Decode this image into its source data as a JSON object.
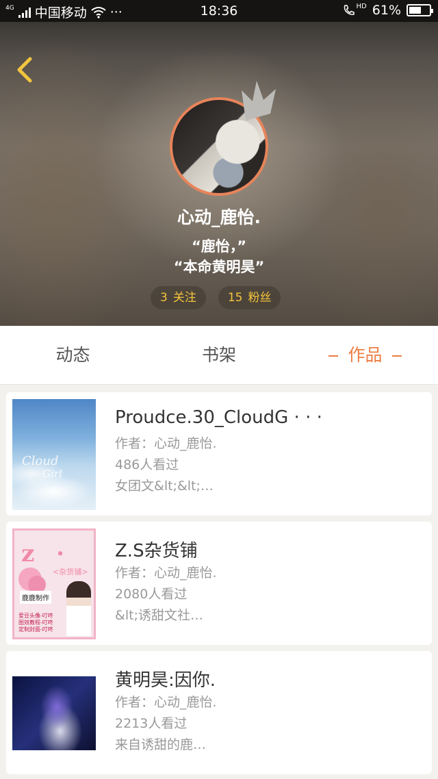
{
  "status_bar": {
    "network": "4G",
    "carrier": "中国移动",
    "more": "···",
    "time": "18:36",
    "hd": "HD",
    "battery_percent": "61%",
    "battery_level": 0.61
  },
  "profile": {
    "nickname": "心动_鹿怡.",
    "bio_line1": "“鹿怡，”",
    "bio_line2": "“本命黄明昊”",
    "following_count": "3",
    "following_label": "关注",
    "fans_count": "15",
    "fans_label": "粉丝"
  },
  "tabs": [
    {
      "label": "动态",
      "active": false
    },
    {
      "label": "书架",
      "active": false
    },
    {
      "label": "作品",
      "active": true
    }
  ],
  "works": [
    {
      "title": "Proudce.30_CloudG · · ·",
      "author": "作者：心动_鹿怡.",
      "views": "486人看过",
      "tag": "女团文&lt;&lt;…",
      "cover_text": [
        "Cloud",
        "Girl"
      ]
    },
    {
      "title": "Z.S杂货铺",
      "author": "作者：心动_鹿怡.",
      "views": "2080人看过",
      "tag": "&lt;诱甜文社…",
      "cover_text": [
        "z · s",
        "<杂货铺>",
        "鹿鹿制作",
        "爱豆头像-叮咚\n图效教程-叮咚\n定制封面-叮咚"
      ]
    },
    {
      "title": "黄明昊:因你.",
      "author": "作者：心动_鹿怡.",
      "views": "2213人看过",
      "tag": "来自诱甜的鹿…"
    }
  ],
  "colors": {
    "accent": "#ec7d43",
    "avatar_ring": "#e8845a",
    "stat_text": "#f5c43b",
    "back_arrow": "#f2c53d"
  }
}
